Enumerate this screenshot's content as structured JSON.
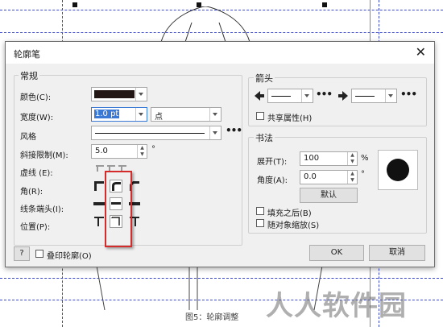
{
  "dialog": {
    "title": "轮廓笔",
    "close": "✕",
    "general": {
      "heading": "常规",
      "color_label": "颜色(C):",
      "color_value": "#231815",
      "width_label": "宽度(W):",
      "width_value": "1.0 pt",
      "width_unit": "点",
      "style_label": "风格",
      "miter_label": "斜接限制(M):",
      "miter_value": "5.0",
      "miter_unit": "°",
      "dash_label": "虚线 (E):",
      "corner_label": "角(R):",
      "cap_label": "线条端头(I):",
      "position_label": "位置(P):"
    },
    "arrows": {
      "heading": "箭头",
      "share_label": "共享属性(H)"
    },
    "calligraphy": {
      "heading": "书法",
      "stretch_label": "展开(T):",
      "stretch_value": "100",
      "stretch_unit": "%",
      "angle_label": "角度(A):",
      "angle_value": "0.0",
      "angle_unit": "°",
      "default_button": "默认",
      "fill_behind_label": "填充之后(B)",
      "scale_label": "随对象缩放(S)"
    },
    "footer": {
      "help": "?",
      "overprint_label": "叠印轮廓(O)",
      "ok": "OK",
      "cancel": "取消"
    }
  },
  "caption": "图5：轮廓调整",
  "watermark": "人人软件园",
  "highlight_color": "#d42b2b"
}
